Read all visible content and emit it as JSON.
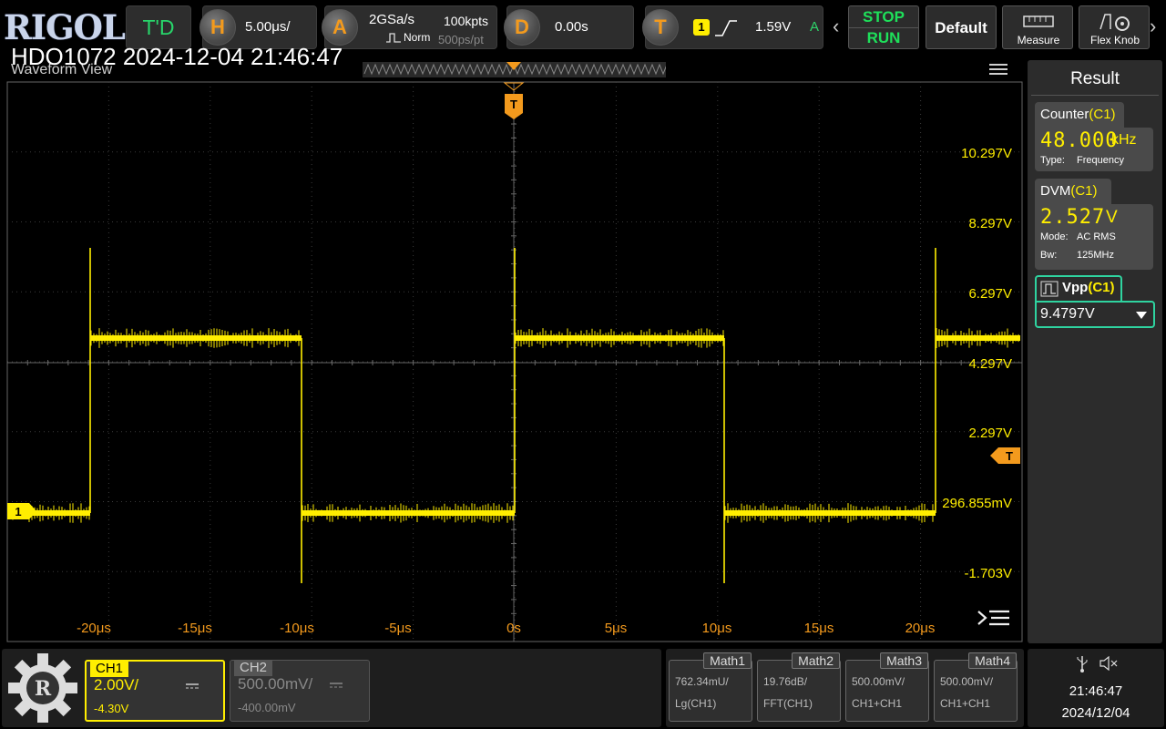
{
  "topbar": {
    "brand": "RIGOL",
    "timebase_mode": "T'D",
    "horizontal": {
      "label": "H",
      "value": "5.00μs/"
    },
    "acquire": {
      "label": "A",
      "sample_rate": "2GSa/s",
      "memory_depth": "100kpts",
      "mode": "Norm",
      "time_per_point": "500ps/pt"
    },
    "delay": {
      "label": "D",
      "value": "0.00s"
    },
    "trigger": {
      "label": "T",
      "source": "1",
      "level": "1.59V",
      "status": "A"
    },
    "stop_label": "STOP",
    "run_label": "RUN",
    "default_label": "Default",
    "measure_label": "Measure",
    "flexknob_label": "Flex Knob"
  },
  "waveform": {
    "scope_id": "HDO1072 2024-12-04 21:46:47",
    "title": "Waveform View",
    "time_labels": [
      "-20μs",
      "-15μs",
      "-10μs",
      "-5μs",
      "0s",
      "5μs",
      "10μs",
      "15μs",
      "20μs"
    ],
    "volt_labels": [
      "10.297V",
      "8.297V",
      "6.297V",
      "4.297V",
      "2.297V",
      "296.855mV",
      "-1.703V"
    ],
    "channel_marker": "1",
    "trigger_marker": "T",
    "trace_color": "#ffee00",
    "trigger_color": "#f39a1d"
  },
  "results": {
    "title": "Result",
    "counter": {
      "label": "Counter",
      "channel": "(C1)",
      "value": "48.000",
      "unit": "kHz",
      "type_label": "Type:",
      "type_value": "Frequency"
    },
    "dvm": {
      "label": "DVM",
      "channel": "(C1)",
      "value": "2.527",
      "unit": "V",
      "mode_label": "Mode:",
      "mode_value": "AC RMS",
      "bw_label": "Bw:",
      "bw_value": "125MHz"
    },
    "vpp": {
      "label": "Vpp",
      "channel": "(C1)",
      "value": "9.4797V"
    }
  },
  "channels": {
    "ch1": {
      "name": "CH1",
      "scale": "2.00V/",
      "offset": "-4.30V"
    },
    "ch2": {
      "name": "CH2",
      "scale": "500.00mV/",
      "offset": "-400.00mV"
    }
  },
  "math": [
    {
      "name": "Math1",
      "scale": "762.34mU/",
      "source": "Lg(CH1)"
    },
    {
      "name": "Math2",
      "scale": "19.76dB/",
      "source": "FFT(CH1)"
    },
    {
      "name": "Math3",
      "scale": "500.00mV/",
      "source": "CH1+CH1"
    },
    {
      "name": "Math4",
      "scale": "500.00mV/",
      "source": "CH1+CH1"
    }
  ],
  "status": {
    "time": "21:46:47",
    "date": "2024/12/04"
  }
}
